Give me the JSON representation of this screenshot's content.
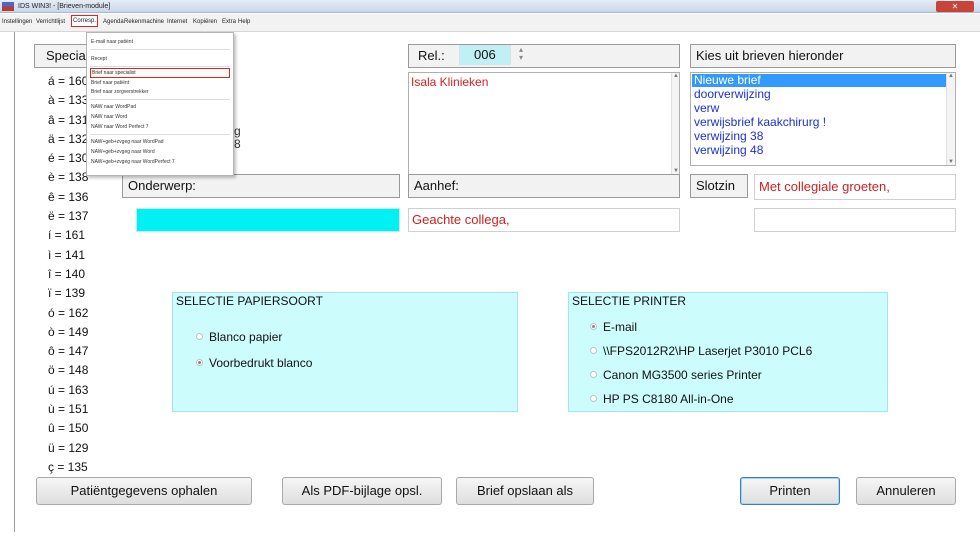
{
  "window": {
    "title": "IDS WIN3! - [Brieven-module]",
    "close_label": "✕"
  },
  "menubar": {
    "items": [
      "Instellingen",
      "Verrichtlijst",
      "Corresp.",
      "Agenda",
      "Rekenmachine",
      "Internet",
      "Kopiëren",
      "Extra",
      "Help"
    ],
    "active_item": "Corresp."
  },
  "dropdown": {
    "items": [
      "E-mail naar patiënt",
      "Recept",
      "Brief naar specialist",
      "Brief naar patiënt",
      "Brief naar zorgverstrekker",
      "NAW naar WordPad",
      "NAW naar Word",
      "NAW naar Word Perfect 7",
      "NAW+geb+zvgeg naar WordPad",
      "NAW+geb+zvgeg naar Word",
      "NAW+geb+zvgeg naar WordPerfect 7"
    ],
    "selected_item": "Brief naar specialist"
  },
  "chars": {
    "header": "Speciale tekens",
    "rows": [
      "á = 160",
      "à = 133",
      "â = 131",
      "ä = 132",
      "é = 130",
      "è = 138",
      "ê = 136",
      "ë = 137",
      "í = 161",
      "ì = 141",
      "î = 140",
      "ï = 139",
      "ó = 162",
      "ò = 149",
      "ô = 147",
      "ö = 148",
      "ú = 163",
      "ù = 151",
      "û = 150",
      "ü = 129",
      "ç = 135"
    ]
  },
  "partially_hidden": {
    "line1": "g",
    "line2": "8"
  },
  "rel": {
    "label": "Rel.:",
    "value": "006"
  },
  "address": {
    "text": "Isala Klinieken"
  },
  "letters": {
    "header": "Kies uit brieven hieronder",
    "items": [
      "Nieuwe brief",
      "doorverwijzing",
      "verw",
      "verwijsbrief kaakchirurg !",
      "verwijzing 38",
      "verwijzing 48"
    ],
    "selected": "Nieuwe brief"
  },
  "fields": {
    "onderwerp_label": "Onderwerp:",
    "onderwerp_value": "",
    "aanhef_label": "Aanhef:",
    "aanhef_value": "Geachte collega,",
    "slotzin_label": "Slotzin",
    "slotzin_value": "Met collegiale groeten,"
  },
  "paper": {
    "title": "SELECTIE PAPIERSOORT",
    "options": [
      "Blanco papier",
      "Voorbedrukt blanco"
    ],
    "selected": "Voorbedrukt blanco"
  },
  "printer": {
    "title": "SELECTIE PRINTER",
    "options": [
      "E-mail",
      "\\\\FPS2012R2\\HP Laserjet P3010 PCL6",
      "Canon MG3500 series Printer",
      "HP PS C8180 All-in-One"
    ],
    "selected": "E-mail"
  },
  "buttons": {
    "fetch_patient": "Patiëntgegevens ophalen",
    "save_pdf": "Als PDF-bijlage opsl.",
    "save_as": "Brief opslaan als",
    "print": "Printen",
    "cancel": "Annuleren"
  },
  "colors": {
    "accent_red": "#cc2222",
    "link_blue": "#1f2fd4",
    "selection_blue": "#3399ff",
    "panel_cyan": "#cdfcfc",
    "subject_cyan": "#00f0f4"
  }
}
